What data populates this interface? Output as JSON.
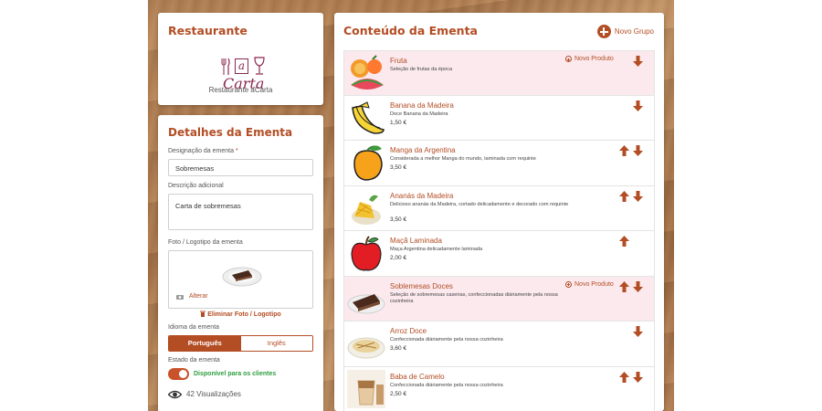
{
  "restaurant": {
    "title": "Restaurante",
    "logo_letter": "a",
    "logo_word": "Carta",
    "name": "Restaurante aCarta"
  },
  "details": {
    "title": "Detalhes da Ementa",
    "designation_label": "Designação da ementa",
    "required_mark": "*",
    "designation_value": "Sobremesas",
    "description_label": "Descrição adicional",
    "description_value": "Carta de sobremesas",
    "photo_label": "Foto / Logotipo da ementa",
    "change_label": "Alterar",
    "delete_photo_label": "Eliminar Foto / Logotipo",
    "language_label": "Idioma da ementa",
    "languages": [
      "Português",
      "Inglês"
    ],
    "selected_language": "Português",
    "state_label": "Estado da ementa",
    "state_value": "Disponível para os clientes",
    "state_on": true,
    "views_count": "42",
    "views_label": "Visualizações"
  },
  "menu": {
    "title": "Conteúdo da Ementa",
    "new_group_label": "Novo Grupo",
    "new_product_label": "Novo Produto",
    "items": [
      {
        "type": "group",
        "name": "Fruta",
        "description": "Seleção de frutas da época",
        "price": "",
        "icon": "fruit-group-icon",
        "up": false,
        "down": true
      },
      {
        "type": "product",
        "name": "Banana da Madeira",
        "description": "Doce Banana da Madeira",
        "price": "1,50 €",
        "icon": "banana-icon",
        "up": false,
        "down": true
      },
      {
        "type": "product",
        "name": "Manga da Argentina",
        "description": "Considerada a melhor Manga do mundo, laminada com requinte",
        "price": "3,50 €",
        "icon": "mango-icon",
        "up": true,
        "down": true
      },
      {
        "type": "product",
        "name": "Ananás da Madeira",
        "description": "Delicioso ananás da Madeira, cortado delicadamente e decorado com requinte",
        "price": "3,50 €",
        "icon": "pineapple-icon",
        "up": true,
        "down": true
      },
      {
        "type": "product",
        "name": "Maçã Laminada",
        "description": "Maça Argentina delicadamente laminada",
        "price": "2,00 €",
        "icon": "apple-icon",
        "up": true,
        "down": false
      },
      {
        "type": "group",
        "name": "Soblemesas Doces",
        "description": "Seleção de sobremesas caseiras, confeccionadas diáriamente pela nossa cozinheira",
        "price": "",
        "icon": "cake-icon",
        "up": true,
        "down": true
      },
      {
        "type": "product",
        "name": "Arroz Doce",
        "description": "Confeccionada diáriamente pela nossa cozinheira",
        "price": "3,60 €",
        "icon": "rice-pudding-icon",
        "up": false,
        "down": true
      },
      {
        "type": "product",
        "name": "Baba de Camelo",
        "description": "Confeccionada diáriamente pela nossa cozinheira",
        "price": "2,50 €",
        "icon": "baba-camelo-icon",
        "up": true,
        "down": true
      }
    ]
  },
  "colors": {
    "accent": "#b34d24",
    "logo": "#8b2750",
    "group_row_bg": "#fbe9ee",
    "status_green": "#2e9e3e"
  }
}
